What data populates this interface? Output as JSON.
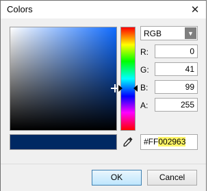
{
  "window": {
    "title": "Colors",
    "close_glyph": "✕"
  },
  "picker": {
    "mode": "RGB",
    "components": [
      {
        "label": "R:",
        "value": "0"
      },
      {
        "label": "G:",
        "value": "41"
      },
      {
        "label": "B:",
        "value": "99"
      },
      {
        "label": "A:",
        "value": "255"
      }
    ],
    "hex_prefix": "#FF",
    "hex_value": "002963",
    "selected_color": "#002963",
    "hue_color": "#0f6bff"
  },
  "buttons": {
    "ok": "OK",
    "cancel": "Cancel"
  }
}
